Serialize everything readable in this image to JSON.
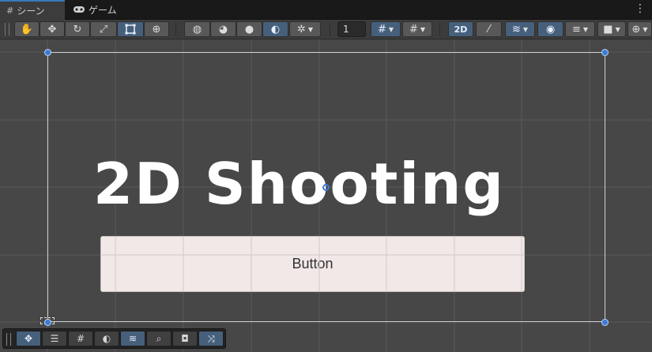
{
  "tabs": [
    {
      "label": "シーン",
      "icon": "grid-icon",
      "active": true
    },
    {
      "label": "ゲーム",
      "icon": "gamepad-icon",
      "active": false
    }
  ],
  "menu": {
    "icon": "kebab-menu-icon"
  },
  "toolbar": {
    "tools": [
      {
        "name": "hand-tool",
        "icon": "hand-icon",
        "selected": false
      },
      {
        "name": "move-tool",
        "icon": "move-icon",
        "selected": false
      },
      {
        "name": "rotate-tool",
        "icon": "rotate-icon",
        "selected": false
      },
      {
        "name": "scale-tool",
        "icon": "scale-icon",
        "selected": false
      },
      {
        "name": "rect-tool",
        "icon": "rect-transform-icon",
        "selected": true
      },
      {
        "name": "transform-tool",
        "icon": "transform-icon",
        "selected": false
      }
    ],
    "shading": [
      {
        "name": "wireframe",
        "icon": "wireframe-sphere-icon",
        "selected": false
      },
      {
        "name": "shaded-wireframe",
        "icon": "shaded-wireframe-icon",
        "selected": false
      },
      {
        "name": "shaded",
        "icon": "shaded-sphere-icon",
        "selected": false
      },
      {
        "name": "unlit",
        "icon": "lighting-icon",
        "selected": true
      }
    ],
    "debug_icon": "debug-bug-icon",
    "grid_size_value": "1",
    "two_d_label": "2D",
    "accent_color": "#46607c"
  },
  "scene": {
    "title_text": "2D Shooting",
    "button_label": "Button",
    "canvas_border_color": "#cfcfcf",
    "button_color": "#f2e8e8"
  },
  "overlay_tools": [
    {
      "name": "move",
      "icon": "move-icon"
    },
    {
      "name": "settings",
      "icon": "sliders-icon"
    },
    {
      "name": "grid-snap",
      "icon": "grid-snap-icon"
    },
    {
      "name": "lighting",
      "icon": "lighting-icon"
    },
    {
      "name": "layers",
      "icon": "layers-icon"
    },
    {
      "name": "search",
      "icon": "search-icon"
    },
    {
      "name": "camera",
      "icon": "camera-icon"
    },
    {
      "name": "shuffle",
      "icon": "shuffle-icon"
    }
  ]
}
